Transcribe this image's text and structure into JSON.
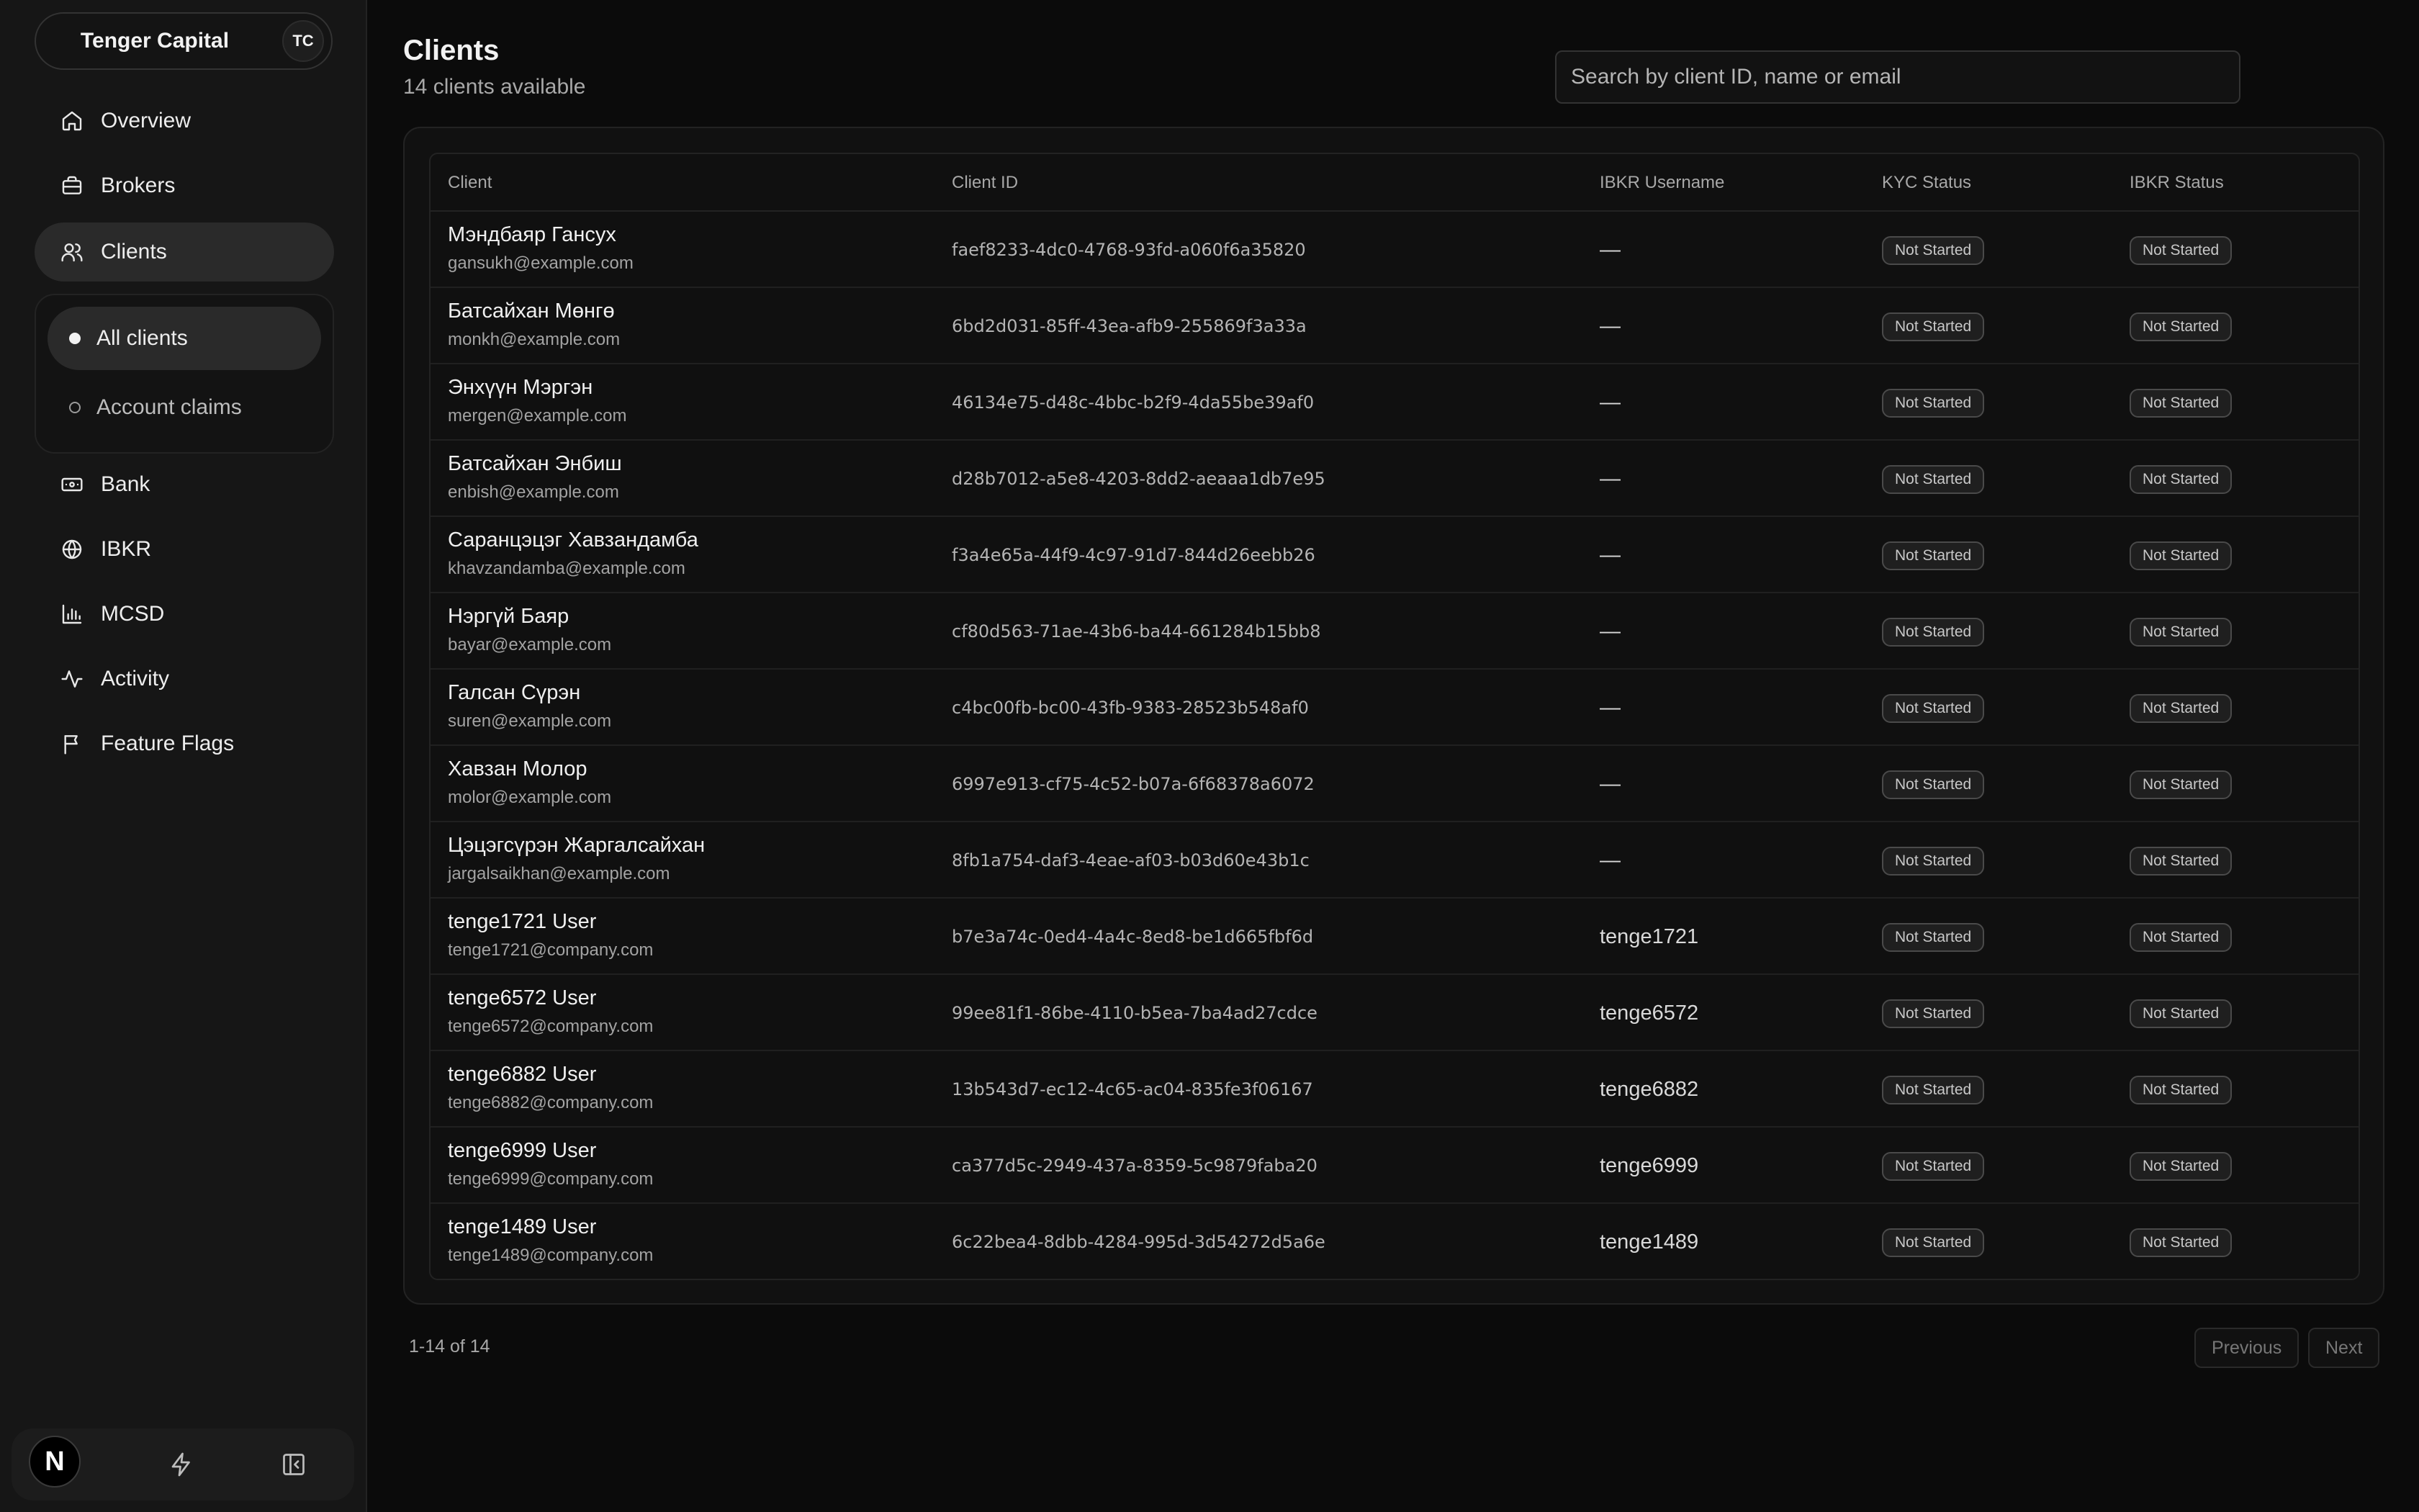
{
  "sidebar": {
    "org_name": "Tenger Capital",
    "org_initials": "TC",
    "nav": [
      {
        "label": "Overview",
        "icon": "home-icon"
      },
      {
        "label": "Brokers",
        "icon": "briefcase-icon"
      },
      {
        "label": "Clients",
        "icon": "users-icon",
        "active": true
      },
      {
        "label": "Bank",
        "icon": "banknote-icon"
      },
      {
        "label": "IBKR",
        "icon": "globe-icon"
      },
      {
        "label": "MCSD",
        "icon": "bar-chart-icon"
      },
      {
        "label": "Activity",
        "icon": "activity-icon"
      },
      {
        "label": "Feature Flags",
        "icon": "flag-icon"
      }
    ],
    "subnav": [
      {
        "label": "All clients",
        "active": true
      },
      {
        "label": "Account claims",
        "active": false
      }
    ],
    "bottom": {
      "badge_letter": "N"
    }
  },
  "header": {
    "title": "Clients",
    "subtitle": "14 clients available",
    "search_placeholder": "Search by client ID, name or email"
  },
  "table": {
    "columns": [
      "Client",
      "Client ID",
      "IBKR Username",
      "KYC Status",
      "IBKR Status"
    ],
    "rows": [
      {
        "name": "Мэндбаяр Гансух",
        "email": "gansukh@example.com",
        "id": "faef8233-4dc0-4768-93fd-a060f6a35820",
        "username": "—",
        "kyc": "Not Started",
        "ibkr": "Not Started"
      },
      {
        "name": "Батсайхан Мөнгө",
        "email": "monkh@example.com",
        "id": "6bd2d031-85ff-43ea-afb9-255869f3a33a",
        "username": "—",
        "kyc": "Not Started",
        "ibkr": "Not Started"
      },
      {
        "name": "Энхүүн Мэргэн",
        "email": "mergen@example.com",
        "id": "46134e75-d48c-4bbc-b2f9-4da55be39af0",
        "username": "—",
        "kyc": "Not Started",
        "ibkr": "Not Started"
      },
      {
        "name": "Батсайхан Энбиш",
        "email": "enbish@example.com",
        "id": "d28b7012-a5e8-4203-8dd2-aeaaa1db7e95",
        "username": "—",
        "kyc": "Not Started",
        "ibkr": "Not Started"
      },
      {
        "name": "Саранцэцэг Хавзандамба",
        "email": "khavzandamba@example.com",
        "id": "f3a4e65a-44f9-4c97-91d7-844d26eebb26",
        "username": "—",
        "kyc": "Not Started",
        "ibkr": "Not Started"
      },
      {
        "name": "Нэргүй Баяр",
        "email": "bayar@example.com",
        "id": "cf80d563-71ae-43b6-ba44-661284b15bb8",
        "username": "—",
        "kyc": "Not Started",
        "ibkr": "Not Started"
      },
      {
        "name": "Галсан Сүрэн",
        "email": "suren@example.com",
        "id": "c4bc00fb-bc00-43fb-9383-28523b548af0",
        "username": "—",
        "kyc": "Not Started",
        "ibkr": "Not Started"
      },
      {
        "name": "Хавзан Молор",
        "email": "molor@example.com",
        "id": "6997e913-cf75-4c52-b07a-6f68378a6072",
        "username": "—",
        "kyc": "Not Started",
        "ibkr": "Not Started"
      },
      {
        "name": "Цэцэгсүрэн Жаргалсайхан",
        "email": "jargalsaikhan@example.com",
        "id": "8fb1a754-daf3-4eae-af03-b03d60e43b1c",
        "username": "—",
        "kyc": "Not Started",
        "ibkr": "Not Started"
      },
      {
        "name": "tenge1721 User",
        "email": "tenge1721@company.com",
        "id": "b7e3a74c-0ed4-4a4c-8ed8-be1d665fbf6d",
        "username": "tenge1721",
        "kyc": "Not Started",
        "ibkr": "Not Started"
      },
      {
        "name": "tenge6572 User",
        "email": "tenge6572@company.com",
        "id": "99ee81f1-86be-4110-b5ea-7ba4ad27cdce",
        "username": "tenge6572",
        "kyc": "Not Started",
        "ibkr": "Not Started"
      },
      {
        "name": "tenge6882 User",
        "email": "tenge6882@company.com",
        "id": "13b543d7-ec12-4c65-ac04-835fe3f06167",
        "username": "tenge6882",
        "kyc": "Not Started",
        "ibkr": "Not Started"
      },
      {
        "name": "tenge6999 User",
        "email": "tenge6999@company.com",
        "id": "ca377d5c-2949-437a-8359-5c9879faba20",
        "username": "tenge6999",
        "kyc": "Not Started",
        "ibkr": "Not Started"
      },
      {
        "name": "tenge1489 User",
        "email": "tenge1489@company.com",
        "id": "6c22bea4-8dbb-4284-995d-3d54272d5a6e",
        "username": "tenge1489",
        "kyc": "Not Started",
        "ibkr": "Not Started"
      }
    ]
  },
  "pagination": {
    "range": "1-14 of 14",
    "previous": "Previous",
    "next": "Next"
  },
  "colors": {
    "background": "#0b0b0b",
    "sidebar": "#161616",
    "active_item": "#2a2a2a",
    "text": "#ededed",
    "muted_text": "#a8a8a8"
  }
}
